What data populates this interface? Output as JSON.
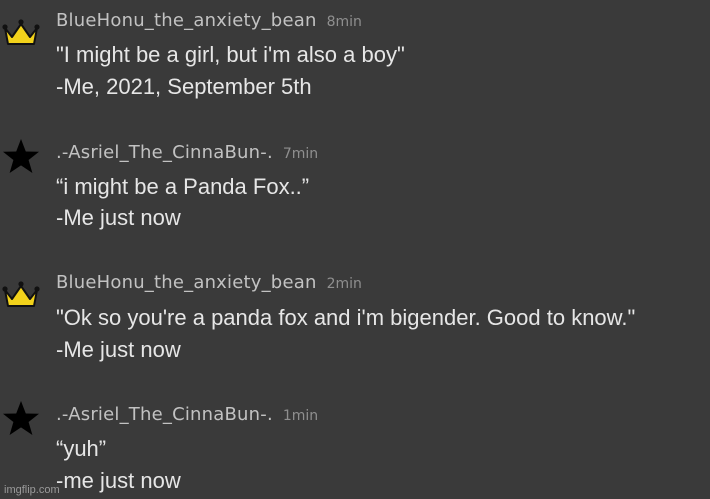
{
  "messages": [
    {
      "username": "BlueHonu_the_anxiety_bean",
      "time": "8min",
      "badge_icon": "crown-icon",
      "lines": [
        "\"I might be a girl, but i'm also a boy\"",
        "-Me, 2021, September 5th"
      ]
    },
    {
      "username": ".-Asriel_The_CinnaBun-.",
      "time": "7min",
      "badge_icon": "star-icon",
      "lines": [
        "“i might be a Panda Fox..”",
        "-Me just now"
      ]
    },
    {
      "username": "BlueHonu_the_anxiety_bean",
      "time": "2min",
      "badge_icon": "crown-icon",
      "lines": [
        "\"Ok so you're a panda fox and i'm bigender. Good to know.\"",
        "-Me just now"
      ]
    },
    {
      "username": ".-Asriel_The_CinnaBun-.",
      "time": "1min",
      "badge_icon": "star-icon",
      "lines": [
        "“yuh”",
        "-me just now"
      ]
    }
  ],
  "watermark": "imgflip.com",
  "colors": {
    "background": "#3a3a3a",
    "crown": "#f2d21b",
    "star": "#000000",
    "username": "#c2c2c2",
    "timestamp": "#8f8f8f",
    "message_text": "#e6e6e6"
  }
}
